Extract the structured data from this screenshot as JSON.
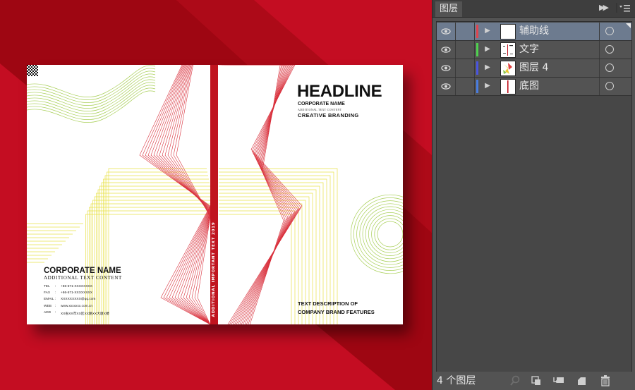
{
  "document": {
    "spine_text": "ADDITIONAL IMPORTANT TEXT 2019",
    "headline": "HEADLINE",
    "corporate_name_small": "CORPORATE NAME",
    "additional_text_small": "ADDITIONAL TEXT CONTENT",
    "creative_branding": "CREATIVE BRANDING",
    "description": "TEXT DESCRIPTION OF\nCOMPANY BRAND FEATURES",
    "corporate_name": "CORPORATE NAME",
    "additional_text": "ADDITIONAL TEXT CONTENT",
    "contact": [
      {
        "key": "TEL",
        "value": "+86-571-XXXXXXXX"
      },
      {
        "key": "FAX",
        "value": "+86-571-XXXXXXXX"
      },
      {
        "key": "EMAIL",
        "value": "XXXXXXXXX@qq.com"
      },
      {
        "key": "WEB",
        "value": "www.xxxxxxx.com.cn"
      },
      {
        "key": "ADD",
        "value": "XX省XX市XX区XX路XX大厦X楼"
      }
    ],
    "contact_separator": ":"
  },
  "layers_panel": {
    "tab_label": "图层",
    "layers": [
      {
        "name": "辅助线",
        "color": "#e0454f",
        "selected": true
      },
      {
        "name": "文字",
        "color": "#4fd14f",
        "selected": false
      },
      {
        "name": "图层 4",
        "color": "#4a55e0",
        "selected": false
      },
      {
        "name": "底图",
        "color": "#4a7de0",
        "selected": false
      }
    ],
    "footer_count": "4 个图层"
  },
  "colors": {
    "canvas_red": "#c40d22",
    "dark_red": "#9e0612",
    "accent_red": "#c0141f",
    "yellow_lines": "#e9e24a",
    "green_lines": "#a8cf57",
    "panel_bg": "#535353",
    "selected_row": "#6d7b8f"
  },
  "icons": [
    "eye-icon",
    "expand-triangle-icon",
    "target-circle-icon",
    "search-icon",
    "clipping-mask-icon",
    "sublayer-icon",
    "new-layer-icon",
    "trash-icon",
    "panel-menu-icon",
    "collapse-icon"
  ]
}
